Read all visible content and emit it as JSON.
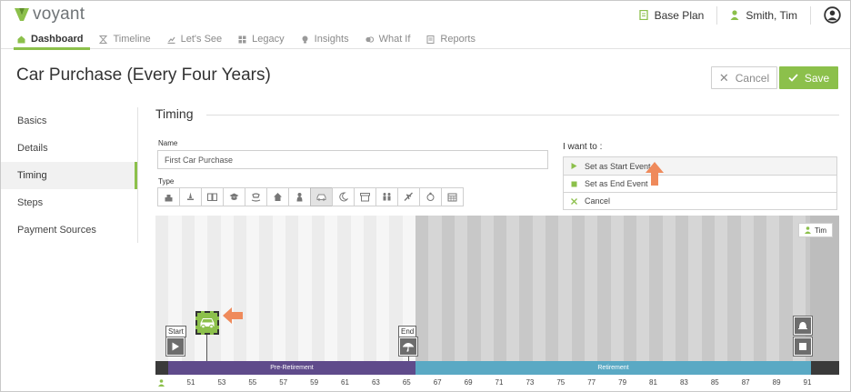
{
  "app": {
    "logo_text": "voyant",
    "brand_color": "#8cc04b"
  },
  "topbar": {
    "plan_label": "Base Plan",
    "plan_icon": "document-icon",
    "user_label": "Smith, Tim",
    "user_icon": "person-icon",
    "account_icon": "account-circle-icon"
  },
  "nav": {
    "items": [
      {
        "label": "Dashboard",
        "icon": "dashboard-icon",
        "active": true
      },
      {
        "label": "Timeline",
        "icon": "hourglass-icon",
        "active": false
      },
      {
        "label": "Let's See",
        "icon": "chart-icon",
        "active": false
      },
      {
        "label": "Legacy",
        "icon": "grid-icon",
        "active": false
      },
      {
        "label": "Insights",
        "icon": "lightbulb-icon",
        "active": false
      },
      {
        "label": "What If",
        "icon": "swap-icon",
        "active": false
      },
      {
        "label": "Reports",
        "icon": "report-icon",
        "active": false
      }
    ]
  },
  "page": {
    "title": "Car Purchase (Every Four Years)",
    "cancel_label": "Cancel",
    "save_label": "Save"
  },
  "side": {
    "items": [
      {
        "label": "Basics",
        "active": false
      },
      {
        "label": "Details",
        "active": false
      },
      {
        "label": "Timing",
        "active": true
      },
      {
        "label": "Steps",
        "active": false
      },
      {
        "label": "Payment Sources",
        "active": false
      }
    ]
  },
  "timing": {
    "section_title": "Timing",
    "name_label": "Name",
    "name_value": "First Car Purchase",
    "type_label": "Type",
    "type_icons": [
      "wedding-cake-icon",
      "graduation-bell-icon",
      "book-icon",
      "mortarboard-icon",
      "rocking-horse-icon",
      "house-icon",
      "baby-icon",
      "car-icon",
      "moon-icon",
      "storefront-icon",
      "family-icon",
      "airplane-icon",
      "piggy-bank-icon",
      "calendar-icon"
    ],
    "type_selected": 7
  },
  "iwant": {
    "label": "I want to :",
    "items": [
      {
        "label": "Set as Start Event",
        "icon": "play-icon",
        "color": "#8cc04b"
      },
      {
        "label": "Set as End Event",
        "icon": "stop-icon",
        "color": "#8cc04b"
      },
      {
        "label": "Cancel",
        "icon": "close-icon",
        "color": "#8cc04b"
      }
    ]
  },
  "timeline": {
    "person_label": "Tim",
    "start_label": "Start",
    "end_label": "End",
    "stages": [
      {
        "label": "Pre-Retirement",
        "color": "#5f4b8b"
      },
      {
        "label": "Retirement",
        "color": "#5aa9c4"
      }
    ],
    "ages": [
      "51",
      "53",
      "55",
      "57",
      "59",
      "61",
      "63",
      "65",
      "67",
      "69",
      "71",
      "73",
      "75",
      "77",
      "79",
      "81",
      "83",
      "85",
      "87",
      "89",
      "91"
    ]
  }
}
